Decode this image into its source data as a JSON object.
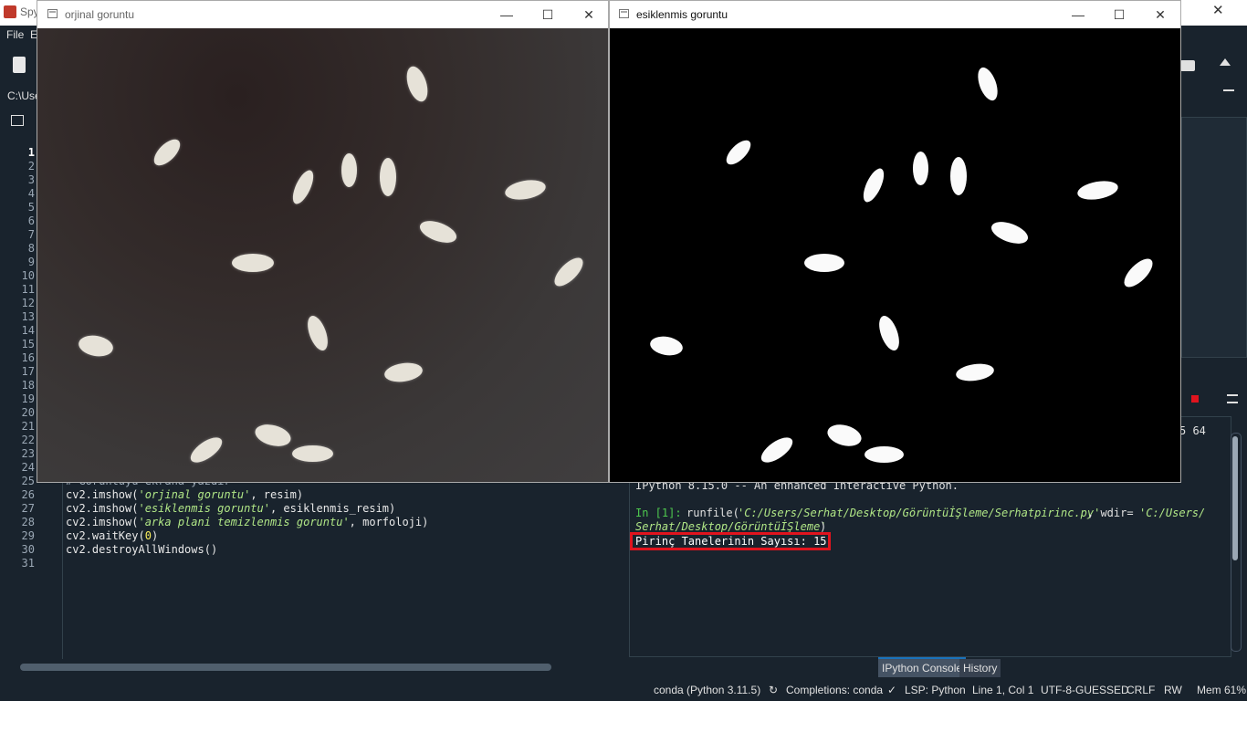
{
  "spyder": {
    "title_fragment": "Spy",
    "menu": [
      "File",
      "E"
    ],
    "path_fragment": "C:\\Use",
    "editor": {
      "line_numbers": [
        "1",
        "2",
        "3",
        "4",
        "5",
        "6",
        "7",
        "8",
        "9",
        "10",
        "11",
        "12",
        "13",
        "14",
        "15",
        "16",
        "17",
        "18",
        "19",
        "20",
        "21",
        "22",
        "23",
        "24",
        "25",
        "26",
        "27",
        "28",
        "29",
        "30",
        "31"
      ],
      "visible_code": [
        {
          "line": "25",
          "text": "# Goruntuyu ekrana yazdir"
        },
        {
          "line": "26",
          "pre": "cv2.imshow(",
          "str": "'orjinal goruntu'",
          "post": ", resim)"
        },
        {
          "line": "27",
          "pre": "cv2.imshow(",
          "str": "'esiklenmis goruntu'",
          "post": ", esiklenmis_resim)"
        },
        {
          "line": "28",
          "pre": "cv2.imshow(",
          "str": "'arka plani temizlenmis goruntu'",
          "post": ", morfoloji)"
        },
        {
          "line": "29",
          "pre": "cv2.waitKey(",
          "num": "0",
          "post": ")"
        },
        {
          "line": "30",
          "pre": "cv2.destroyAllWindows()"
        },
        {
          "line": "31",
          "pre": ""
        }
      ]
    },
    "console": {
      "header_fragment": "5 64",
      "banner": "IPython 8.15.0 -- An enhanced Interactive Python.",
      "prompt": "In [1]:",
      "command": "runfile(",
      "arg1": "'C:/Users/Serhat/Desktop/GörüntüİŞleme/Serhatpirinc.py'",
      "sep": ", wdir=",
      "arg2a": "'C:/Users/",
      "arg2b": "Serhat/Desktop/GörüntüİŞleme'",
      "close": ")",
      "output": "Pirinç Tanelerinin Sayısı: 15",
      "tabs": [
        "IPython Console",
        "History"
      ]
    },
    "status": {
      "env": "conda (Python 3.11.5)",
      "completions": "Completions: conda",
      "lsp": "LSP: Python",
      "position": "Line 1, Col 1",
      "encoding": "UTF-8-GUESSED",
      "eol": "CRLF",
      "mode": "RW",
      "mem": "Mem 61%"
    },
    "colors": {
      "background": "#19232d",
      "highlight_box": "#e0141e",
      "prompt": "#4ec94e",
      "string": "#b0e686"
    }
  },
  "windows": {
    "original": {
      "title": "orjinal goruntu"
    },
    "threshold": {
      "title": "esiklenmis goruntu"
    },
    "controls": {
      "minimize": "—",
      "maximize": "☐",
      "close": "✕"
    }
  }
}
